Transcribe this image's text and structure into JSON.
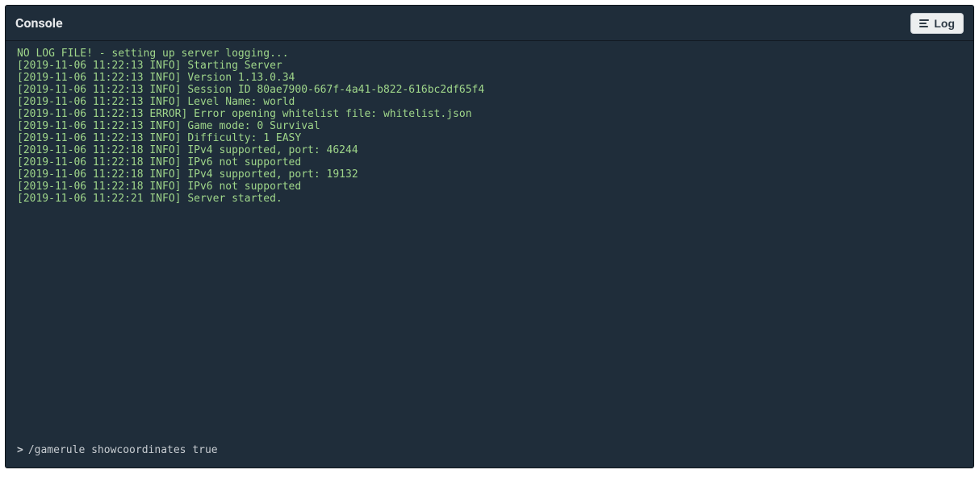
{
  "header": {
    "title": "Console",
    "log_button": "Log"
  },
  "console": {
    "lines": [
      "NO LOG FILE! - setting up server logging...",
      "[2019-11-06 11:22:13 INFO] Starting Server",
      "[2019-11-06 11:22:13 INFO] Version 1.13.0.34",
      "[2019-11-06 11:22:13 INFO] Session ID 80ae7900-667f-4a41-b822-616bc2df65f4",
      "[2019-11-06 11:22:13 INFO] Level Name: world",
      "[2019-11-06 11:22:13 ERROR] Error opening whitelist file: whitelist.json",
      "[2019-11-06 11:22:13 INFO] Game mode: 0 Survival",
      "[2019-11-06 11:22:13 INFO] Difficulty: 1 EASY",
      "[2019-11-06 11:22:18 INFO] IPv4 supported, port: 46244",
      "[2019-11-06 11:22:18 INFO] IPv6 not supported",
      "[2019-11-06 11:22:18 INFO] IPv4 supported, port: 19132",
      "[2019-11-06 11:22:18 INFO] IPv6 not supported",
      "[2019-11-06 11:22:21 INFO] Server started."
    ]
  },
  "input": {
    "prompt": ">",
    "value": "/gamerule showcoordinates true"
  },
  "colors": {
    "panel_bg": "#1f2d3a",
    "log_text": "#9fd68a",
    "input_text": "#c7ccd1",
    "button_bg": "#eceeef"
  }
}
